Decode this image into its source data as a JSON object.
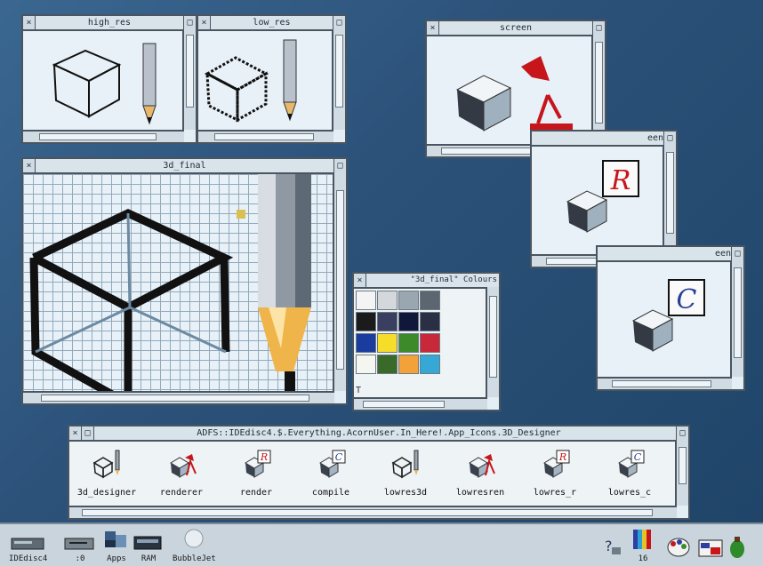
{
  "windows": {
    "high_res": {
      "title": "high_res"
    },
    "low_res": {
      "title": "low_res"
    },
    "screen": {
      "title": "screen"
    },
    "screen2": {
      "title": "een"
    },
    "screen3": {
      "title": "een"
    },
    "final": {
      "title": "3d_final"
    },
    "colours": {
      "title": "\"3d_final\" Colours",
      "marker": "T",
      "swatches": [
        "#f4f4f4",
        "#d4d8dc",
        "#9aa6b0",
        "#5c6670",
        "#1b1b1b",
        "#3a3f60",
        "#10173a",
        "#2a2f45",
        "#1a3c9e",
        "#f6dd2a",
        "#3d8a2a",
        "#c8283a",
        "#f6f6f0",
        "#3a6a2a",
        "#f3a23a",
        "#36a8d6"
      ]
    },
    "filer": {
      "title": "ADFS::IDEdisc4.$.Everything.AcornUser.In_Here!.App_Icons.3D_Designer",
      "items": [
        {
          "label": "3d_designer",
          "icon": "cube-pencil-icon"
        },
        {
          "label": "renderer",
          "icon": "cube-lamp-icon"
        },
        {
          "label": "render",
          "icon": "cube-r-icon"
        },
        {
          "label": "compile",
          "icon": "cube-c-icon"
        },
        {
          "label": "lowres3d",
          "icon": "cube-pencil-icon"
        },
        {
          "label": "lowresren",
          "icon": "cube-lamp-icon"
        },
        {
          "label": "lowres_r",
          "icon": "cube-r-icon"
        },
        {
          "label": "lowres_c",
          "icon": "cube-c-icon"
        }
      ]
    }
  },
  "glyphs": {
    "close": "×",
    "toggle": "□",
    "r_letter": "R",
    "c_letter": "C"
  },
  "iconbar": {
    "left": [
      {
        "label": "IDEdisc4",
        "icon": "hard-disc-icon"
      },
      {
        "label": ":0",
        "icon": "floppy-drive-icon"
      },
      {
        "label": "Apps",
        "icon": "apps-icon"
      },
      {
        "label": "RAM",
        "icon": "ram-disc-icon"
      },
      {
        "label": "BubbleJet",
        "icon": "printer-icon"
      }
    ],
    "right": [
      {
        "label": "",
        "icon": "help-icon"
      },
      {
        "label": "16",
        "icon": "display-manager-icon"
      },
      {
        "label": "",
        "icon": "palette-icon"
      },
      {
        "label": "",
        "icon": "task-manager-icon"
      },
      {
        "label": "",
        "icon": "acorn-icon"
      }
    ]
  }
}
